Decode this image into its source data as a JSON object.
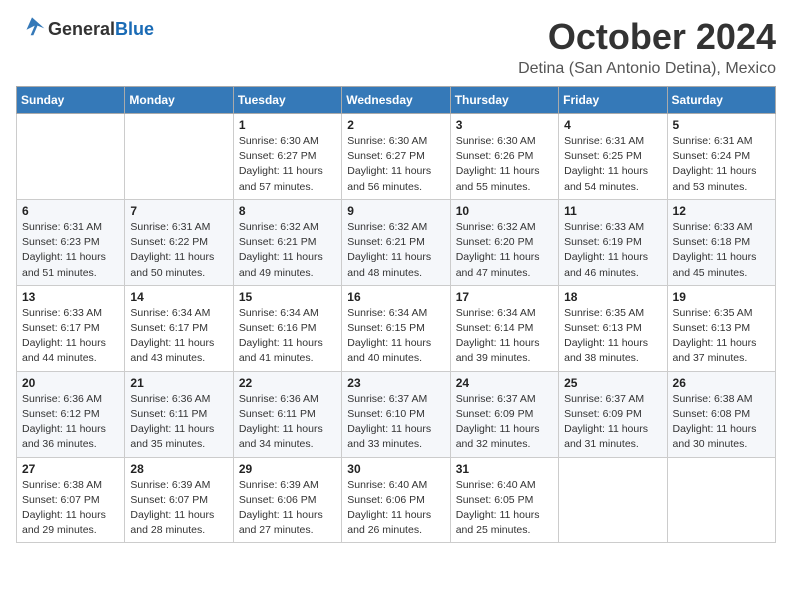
{
  "logo": {
    "text_general": "General",
    "text_blue": "Blue"
  },
  "title": {
    "month": "October 2024",
    "location": "Detina (San Antonio Detina), Mexico"
  },
  "headers": [
    "Sunday",
    "Monday",
    "Tuesday",
    "Wednesday",
    "Thursday",
    "Friday",
    "Saturday"
  ],
  "weeks": [
    [
      {
        "day": "",
        "sunrise": "",
        "sunset": "",
        "daylight": ""
      },
      {
        "day": "",
        "sunrise": "",
        "sunset": "",
        "daylight": ""
      },
      {
        "day": "1",
        "sunrise": "Sunrise: 6:30 AM",
        "sunset": "Sunset: 6:27 PM",
        "daylight": "Daylight: 11 hours and 57 minutes."
      },
      {
        "day": "2",
        "sunrise": "Sunrise: 6:30 AM",
        "sunset": "Sunset: 6:27 PM",
        "daylight": "Daylight: 11 hours and 56 minutes."
      },
      {
        "day": "3",
        "sunrise": "Sunrise: 6:30 AM",
        "sunset": "Sunset: 6:26 PM",
        "daylight": "Daylight: 11 hours and 55 minutes."
      },
      {
        "day": "4",
        "sunrise": "Sunrise: 6:31 AM",
        "sunset": "Sunset: 6:25 PM",
        "daylight": "Daylight: 11 hours and 54 minutes."
      },
      {
        "day": "5",
        "sunrise": "Sunrise: 6:31 AM",
        "sunset": "Sunset: 6:24 PM",
        "daylight": "Daylight: 11 hours and 53 minutes."
      }
    ],
    [
      {
        "day": "6",
        "sunrise": "Sunrise: 6:31 AM",
        "sunset": "Sunset: 6:23 PM",
        "daylight": "Daylight: 11 hours and 51 minutes."
      },
      {
        "day": "7",
        "sunrise": "Sunrise: 6:31 AM",
        "sunset": "Sunset: 6:22 PM",
        "daylight": "Daylight: 11 hours and 50 minutes."
      },
      {
        "day": "8",
        "sunrise": "Sunrise: 6:32 AM",
        "sunset": "Sunset: 6:21 PM",
        "daylight": "Daylight: 11 hours and 49 minutes."
      },
      {
        "day": "9",
        "sunrise": "Sunrise: 6:32 AM",
        "sunset": "Sunset: 6:21 PM",
        "daylight": "Daylight: 11 hours and 48 minutes."
      },
      {
        "day": "10",
        "sunrise": "Sunrise: 6:32 AM",
        "sunset": "Sunset: 6:20 PM",
        "daylight": "Daylight: 11 hours and 47 minutes."
      },
      {
        "day": "11",
        "sunrise": "Sunrise: 6:33 AM",
        "sunset": "Sunset: 6:19 PM",
        "daylight": "Daylight: 11 hours and 46 minutes."
      },
      {
        "day": "12",
        "sunrise": "Sunrise: 6:33 AM",
        "sunset": "Sunset: 6:18 PM",
        "daylight": "Daylight: 11 hours and 45 minutes."
      }
    ],
    [
      {
        "day": "13",
        "sunrise": "Sunrise: 6:33 AM",
        "sunset": "Sunset: 6:17 PM",
        "daylight": "Daylight: 11 hours and 44 minutes."
      },
      {
        "day": "14",
        "sunrise": "Sunrise: 6:34 AM",
        "sunset": "Sunset: 6:17 PM",
        "daylight": "Daylight: 11 hours and 43 minutes."
      },
      {
        "day": "15",
        "sunrise": "Sunrise: 6:34 AM",
        "sunset": "Sunset: 6:16 PM",
        "daylight": "Daylight: 11 hours and 41 minutes."
      },
      {
        "day": "16",
        "sunrise": "Sunrise: 6:34 AM",
        "sunset": "Sunset: 6:15 PM",
        "daylight": "Daylight: 11 hours and 40 minutes."
      },
      {
        "day": "17",
        "sunrise": "Sunrise: 6:34 AM",
        "sunset": "Sunset: 6:14 PM",
        "daylight": "Daylight: 11 hours and 39 minutes."
      },
      {
        "day": "18",
        "sunrise": "Sunrise: 6:35 AM",
        "sunset": "Sunset: 6:13 PM",
        "daylight": "Daylight: 11 hours and 38 minutes."
      },
      {
        "day": "19",
        "sunrise": "Sunrise: 6:35 AM",
        "sunset": "Sunset: 6:13 PM",
        "daylight": "Daylight: 11 hours and 37 minutes."
      }
    ],
    [
      {
        "day": "20",
        "sunrise": "Sunrise: 6:36 AM",
        "sunset": "Sunset: 6:12 PM",
        "daylight": "Daylight: 11 hours and 36 minutes."
      },
      {
        "day": "21",
        "sunrise": "Sunrise: 6:36 AM",
        "sunset": "Sunset: 6:11 PM",
        "daylight": "Daylight: 11 hours and 35 minutes."
      },
      {
        "day": "22",
        "sunrise": "Sunrise: 6:36 AM",
        "sunset": "Sunset: 6:11 PM",
        "daylight": "Daylight: 11 hours and 34 minutes."
      },
      {
        "day": "23",
        "sunrise": "Sunrise: 6:37 AM",
        "sunset": "Sunset: 6:10 PM",
        "daylight": "Daylight: 11 hours and 33 minutes."
      },
      {
        "day": "24",
        "sunrise": "Sunrise: 6:37 AM",
        "sunset": "Sunset: 6:09 PM",
        "daylight": "Daylight: 11 hours and 32 minutes."
      },
      {
        "day": "25",
        "sunrise": "Sunrise: 6:37 AM",
        "sunset": "Sunset: 6:09 PM",
        "daylight": "Daylight: 11 hours and 31 minutes."
      },
      {
        "day": "26",
        "sunrise": "Sunrise: 6:38 AM",
        "sunset": "Sunset: 6:08 PM",
        "daylight": "Daylight: 11 hours and 30 minutes."
      }
    ],
    [
      {
        "day": "27",
        "sunrise": "Sunrise: 6:38 AM",
        "sunset": "Sunset: 6:07 PM",
        "daylight": "Daylight: 11 hours and 29 minutes."
      },
      {
        "day": "28",
        "sunrise": "Sunrise: 6:39 AM",
        "sunset": "Sunset: 6:07 PM",
        "daylight": "Daylight: 11 hours and 28 minutes."
      },
      {
        "day": "29",
        "sunrise": "Sunrise: 6:39 AM",
        "sunset": "Sunset: 6:06 PM",
        "daylight": "Daylight: 11 hours and 27 minutes."
      },
      {
        "day": "30",
        "sunrise": "Sunrise: 6:40 AM",
        "sunset": "Sunset: 6:06 PM",
        "daylight": "Daylight: 11 hours and 26 minutes."
      },
      {
        "day": "31",
        "sunrise": "Sunrise: 6:40 AM",
        "sunset": "Sunset: 6:05 PM",
        "daylight": "Daylight: 11 hours and 25 minutes."
      },
      {
        "day": "",
        "sunrise": "",
        "sunset": "",
        "daylight": ""
      },
      {
        "day": "",
        "sunrise": "",
        "sunset": "",
        "daylight": ""
      }
    ]
  ]
}
